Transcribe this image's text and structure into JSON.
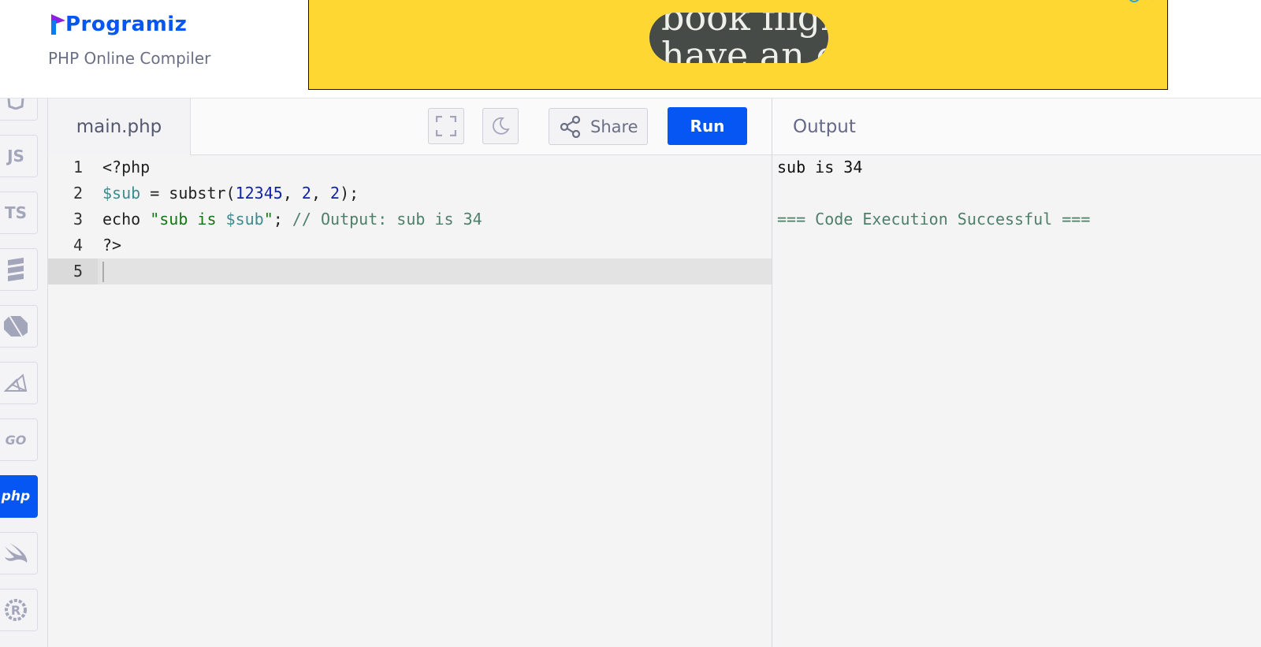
{
  "brand": {
    "logo_text": "Programiz",
    "subtitle": "PHP Online Compiler",
    "accent": "#0556f3"
  },
  "ad": {
    "line1": "book fligh",
    "line2": "have an e",
    "background": "#fed733"
  },
  "sidebar": {
    "items": [
      {
        "label": "",
        "icon": "html5-icon"
      },
      {
        "label": "JS",
        "icon": "javascript-icon"
      },
      {
        "label": "TS",
        "icon": "typescript-icon"
      },
      {
        "label": "",
        "icon": "sql-icon"
      },
      {
        "label": "",
        "icon": "dart-icon"
      },
      {
        "label": "",
        "icon": "ruby-icon"
      },
      {
        "label": "GO",
        "icon": "go-icon"
      },
      {
        "label": "php",
        "icon": "php-icon",
        "active": true
      },
      {
        "label": "",
        "icon": "swift-icon"
      },
      {
        "label": "",
        "icon": "rust-icon"
      }
    ]
  },
  "editor": {
    "tab_label": "main.php",
    "share_label": "Share",
    "run_label": "Run",
    "line_numbers": [
      "1",
      "2",
      "3",
      "4",
      "5"
    ],
    "lines": [
      [
        {
          "t": "<?php",
          "c": "plain"
        }
      ],
      [
        {
          "t": "$sub",
          "c": "var"
        },
        {
          "t": " = substr(",
          "c": "plain"
        },
        {
          "t": "12345",
          "c": "num"
        },
        {
          "t": ", ",
          "c": "plain"
        },
        {
          "t": "2",
          "c": "num"
        },
        {
          "t": ", ",
          "c": "plain"
        },
        {
          "t": "2",
          "c": "num"
        },
        {
          "t": ");",
          "c": "plain"
        }
      ],
      [
        {
          "t": "echo ",
          "c": "plain"
        },
        {
          "t": "\"sub is ",
          "c": "str"
        },
        {
          "t": "$sub",
          "c": "var"
        },
        {
          "t": "\"",
          "c": "str"
        },
        {
          "t": "; ",
          "c": "plain"
        },
        {
          "t": "// Output: sub is 34",
          "c": "com"
        }
      ],
      [
        {
          "t": "?>",
          "c": "plain"
        }
      ],
      []
    ]
  },
  "output": {
    "title": "Output",
    "lines": [
      "sub is 34",
      "",
      "=== Code Execution Successful ==="
    ],
    "success_color": "#4e7f6a"
  }
}
